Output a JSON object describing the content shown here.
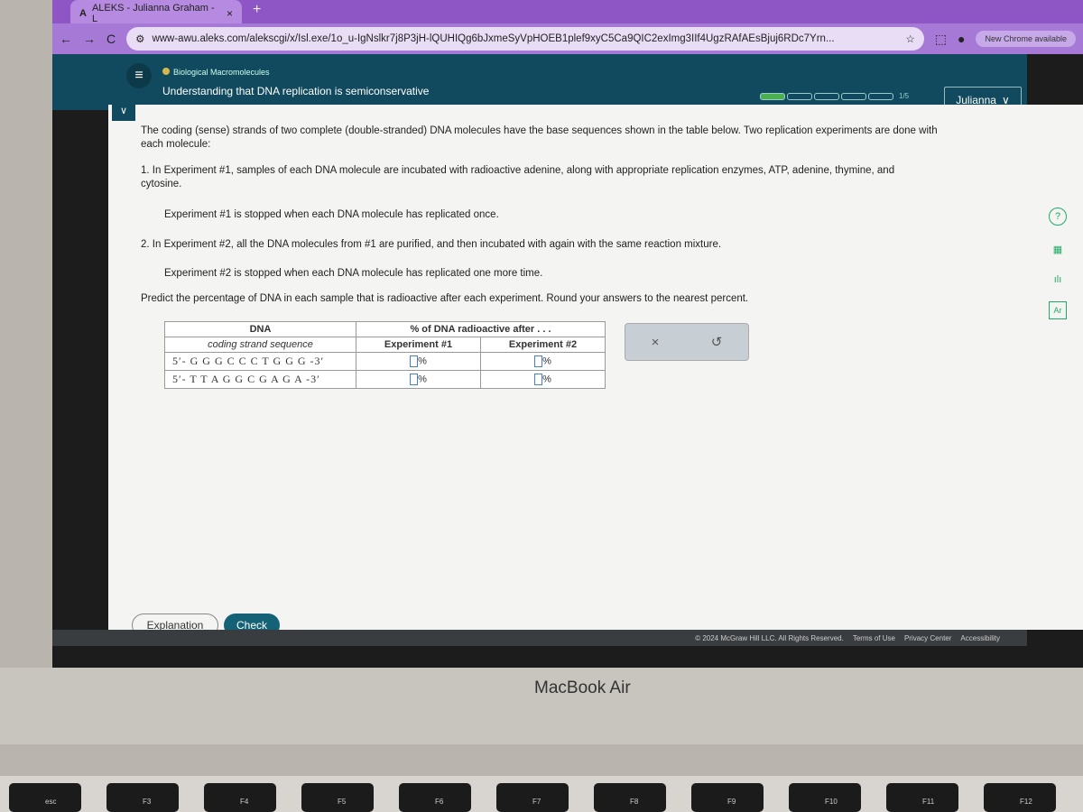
{
  "browser": {
    "tab_title": "ALEKS - Julianna Graham - L",
    "url": "www-awu.aleks.com/alekscgi/x/Isl.exe/1o_u-IgNslkr7j8P3jH-lQUHIQg6bJxmeSyVpHOEB1plef9xyC5Ca9QIC2exImg3IIf4UgzRAfAEsBjuj6RDc7Yrn...",
    "new_chrome": "New Chrome available"
  },
  "header": {
    "topic": "Biological Macromolecules",
    "title": "Understanding that DNA replication is semiconservative",
    "progress": {
      "completed": 1,
      "total": 5,
      "label": "1/5"
    },
    "user": "Julianna"
  },
  "question": {
    "intro": "The coding (sense) strands of two complete (double-stranded) DNA molecules have the base sequences shown in the table below. Two replication experiments are done with each molecule:",
    "step1": "1.  In Experiment #1, samples of each DNA molecule are incubated with radioactive adenine, along with appropriate replication enzymes, ATP, adenine, thymine, and cytosine.",
    "step1_stop": "Experiment #1 is stopped when each DNA molecule has replicated once.",
    "step2": "2.  In Experiment #2, all the DNA molecules from #1 are purified, and then incubated with again with the same reaction mixture.",
    "step2_stop": "Experiment #2 is stopped when each DNA molecule has replicated one more time.",
    "prompt": "Predict the percentage of DNA in each sample that is radioactive after each experiment. Round your answers to the nearest percent."
  },
  "table": {
    "col_dna": "DNA",
    "col_dna_sub": "coding strand sequence",
    "col_pct": "% of DNA radioactive after . . .",
    "exp1": "Experiment #1",
    "exp2": "Experiment #2",
    "unit": "%",
    "rows": [
      {
        "seq": "5′- G G G C C C T G G G -3′",
        "exp1": "",
        "exp2": ""
      },
      {
        "seq": "5′- T T A G G C G A G A -3′",
        "exp1": "",
        "exp2": ""
      }
    ]
  },
  "tools": {
    "clear": "×",
    "undo": "↺"
  },
  "side_tools": {
    "help": "?",
    "calculator": "▦",
    "chart": "ılı",
    "periodic": "Ar"
  },
  "buttons": {
    "explanation": "Explanation",
    "check": "Check"
  },
  "footer": {
    "copyright": "© 2024 McGraw Hill LLC. All Rights Reserved.",
    "terms": "Terms of Use",
    "privacy": "Privacy Center",
    "accessibility": "Accessibility"
  },
  "laptop": {
    "brand": "MacBook Air",
    "keys": [
      "esc",
      "F3",
      "F4",
      "F5",
      "F6",
      "F7",
      "F8",
      "F9",
      "F10",
      "F11",
      "F12"
    ]
  }
}
